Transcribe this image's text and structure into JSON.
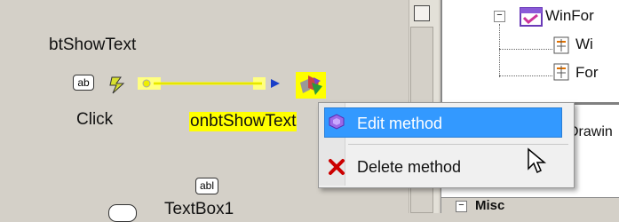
{
  "designer": {
    "button_name": "btShowText",
    "button_icon_text": "ab",
    "event_label": "Click",
    "handler_name": "onbtShowText",
    "textbox_icon_text": "abl",
    "textbox_name": "TextBox1"
  },
  "context_menu": {
    "items": [
      {
        "label": "Edit method",
        "icon": "edit-method-icon",
        "highlighted": true
      },
      {
        "label": "Delete method",
        "icon": "delete-x-icon",
        "highlighted": false
      }
    ]
  },
  "tree": {
    "root_label": "WinFor",
    "child1_label": "Wi",
    "child2_label": "For"
  },
  "properties": {
    "drawing_label": "Drawin",
    "misc_label": "Misc"
  },
  "colors": {
    "highlight": "#3399ff",
    "handler_bg": "#ffff00",
    "delete_icon": "#cc0000"
  }
}
